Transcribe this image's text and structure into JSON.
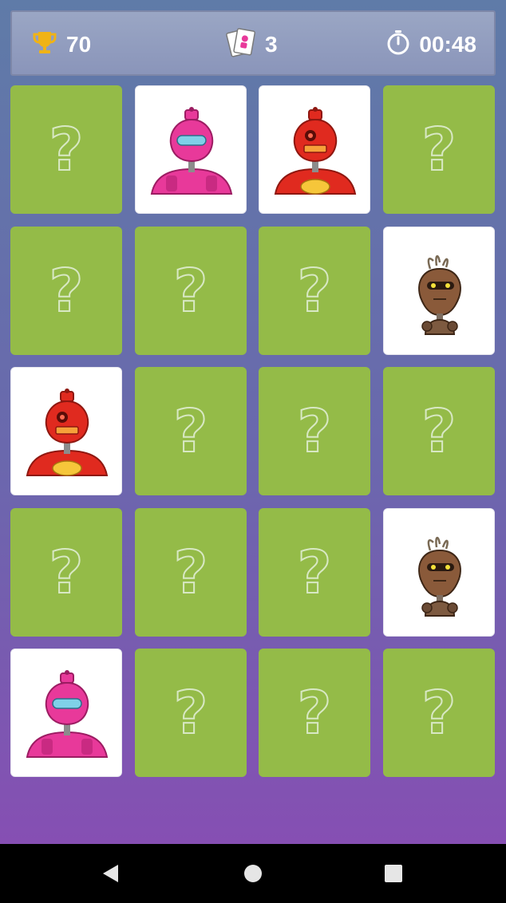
{
  "header": {
    "score": "70",
    "moves": "3",
    "timer": "00:48",
    "icons": {
      "score": "trophy-icon",
      "moves": "cards-icon",
      "timer": "stopwatch-icon"
    }
  },
  "board": {
    "hidden_symbol": "?",
    "colors": {
      "card_back": "#94bb48",
      "card_face": "#ffffff"
    },
    "cards": [
      {
        "state": "hidden"
      },
      {
        "state": "revealed",
        "character": "pink-robot"
      },
      {
        "state": "revealed",
        "character": "red-robot"
      },
      {
        "state": "hidden"
      },
      {
        "state": "hidden"
      },
      {
        "state": "hidden"
      },
      {
        "state": "hidden"
      },
      {
        "state": "revealed",
        "character": "brown-robot"
      },
      {
        "state": "revealed",
        "character": "red-robot"
      },
      {
        "state": "hidden"
      },
      {
        "state": "hidden"
      },
      {
        "state": "hidden"
      },
      {
        "state": "hidden"
      },
      {
        "state": "hidden"
      },
      {
        "state": "hidden"
      },
      {
        "state": "revealed",
        "character": "brown-robot"
      },
      {
        "state": "revealed",
        "character": "pink-robot"
      },
      {
        "state": "hidden"
      },
      {
        "state": "hidden"
      },
      {
        "state": "hidden"
      }
    ]
  },
  "navigation": {
    "buttons": [
      "back-icon",
      "home-icon",
      "recents-icon"
    ]
  }
}
